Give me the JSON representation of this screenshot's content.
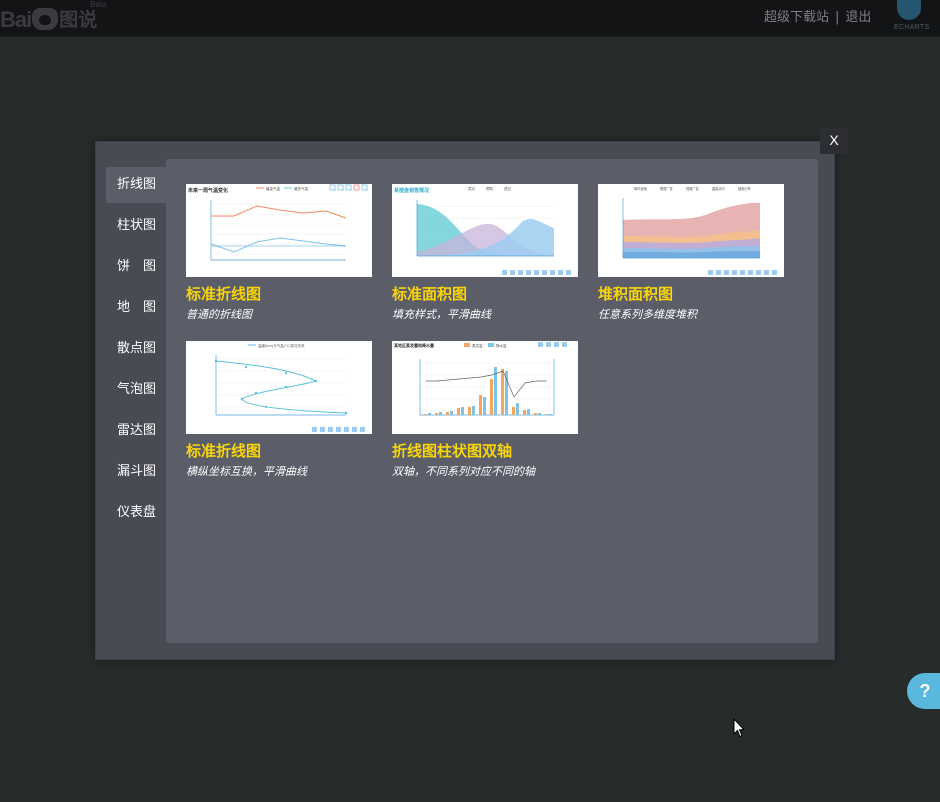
{
  "header": {
    "logo_bai": "Bai",
    "logo_tushuo": "图说",
    "logo_beta": "Beta",
    "links": [
      "超级下载站",
      "|",
      "退出"
    ],
    "echarts_logo": "ECHARTS"
  },
  "modal": {
    "close_label": "X",
    "sidebar": [
      {
        "label": "折线图",
        "active": true
      },
      {
        "label": "柱状图",
        "active": false
      },
      {
        "label": "饼　图",
        "active": false
      },
      {
        "label": "地　图",
        "active": false
      },
      {
        "label": "散点图",
        "active": false
      },
      {
        "label": "气泡图",
        "active": false
      },
      {
        "label": "雷达图",
        "active": false
      },
      {
        "label": "漏斗图",
        "active": false
      },
      {
        "label": "仪表盘",
        "active": false
      }
    ],
    "cards": [
      {
        "title": "标准折线图",
        "desc": "普通的折线图",
        "thumb_title": "未来一周气温变化",
        "legend": [
          "最高气温",
          "最低气温"
        ]
      },
      {
        "title": "标准面积图",
        "desc": "填充样式，平滑曲线",
        "thumb_title": "某楼盘销售情况",
        "legend": [
          "意向",
          "预购",
          "成交"
        ]
      },
      {
        "title": "堆积面积图",
        "desc": "任意系列多维度堆积",
        "thumb_title": "",
        "legend": [
          "邮件营销",
          "联盟广告",
          "视频广告",
          "直接访问",
          "搜索引擎"
        ]
      },
      {
        "title": "标准折线图",
        "desc": "横纵坐标互换，平滑曲线",
        "thumb_title": "",
        "legend": [
          "高度(km)与气温(°C)变化关系"
        ]
      },
      {
        "title": "折线图柱状图双轴",
        "desc": "双轴，不同系列对应不同的轴",
        "thumb_title": "某地区蒸发量和降水量",
        "legend": [
          "蒸发量",
          "降水量"
        ]
      }
    ]
  },
  "help_label": "?",
  "colors": {
    "accent_title": "#f7d40a",
    "help": "#5ab8de",
    "panel": "#5b5d69"
  }
}
